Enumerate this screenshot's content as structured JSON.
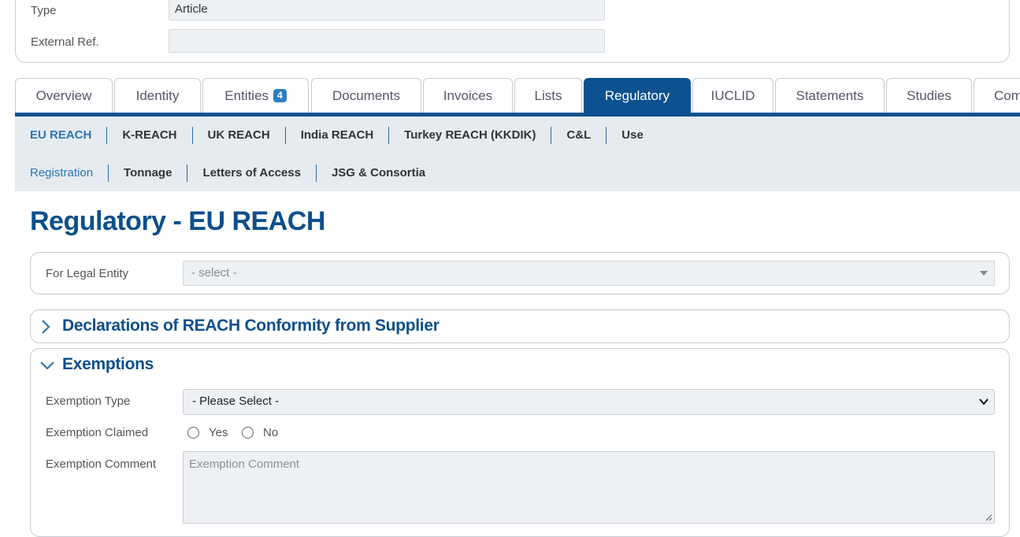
{
  "top_panel": {
    "type_label": "Type",
    "type_value": "Article",
    "extref_label": "External Ref.",
    "extref_value": ""
  },
  "tabs": [
    {
      "label": "Overview"
    },
    {
      "label": "Identity"
    },
    {
      "label": "Entities",
      "badge": "4"
    },
    {
      "label": "Documents"
    },
    {
      "label": "Invoices"
    },
    {
      "label": "Lists"
    },
    {
      "label": "Regulatory",
      "active": true
    },
    {
      "label": "IUCLID"
    },
    {
      "label": "Statements"
    },
    {
      "label": "Studies"
    },
    {
      "label": "Com"
    }
  ],
  "subnav_primary": [
    "EU REACH",
    "K-REACH",
    "UK REACH",
    "India REACH",
    "Turkey REACH (KKDIK)",
    "C&L",
    "Use"
  ],
  "subnav_secondary": [
    "Registration",
    "Tonnage",
    "Letters of Access",
    "JSG & Consortia"
  ],
  "page_title": "Regulatory - EU REACH",
  "legal_entity": {
    "label": "For Legal Entity",
    "placeholder": "- select -"
  },
  "declarations": {
    "title": "Declarations of REACH Conformity from Supplier",
    "expanded": false
  },
  "exemptions": {
    "title": "Exemptions",
    "expanded": true,
    "type_label": "Exemption Type",
    "type_value": "- Please Select -",
    "claimed_label": "Exemption Claimed",
    "yes_label": "Yes",
    "no_label": "No",
    "comment_label": "Exemption Comment",
    "comment_placeholder": "Exemption Comment"
  },
  "colors": {
    "brand": "#0d5290",
    "title": "#0d4f8a",
    "subnav_active": "#2a77b5",
    "subnav_bg": "#e6ebf0"
  }
}
